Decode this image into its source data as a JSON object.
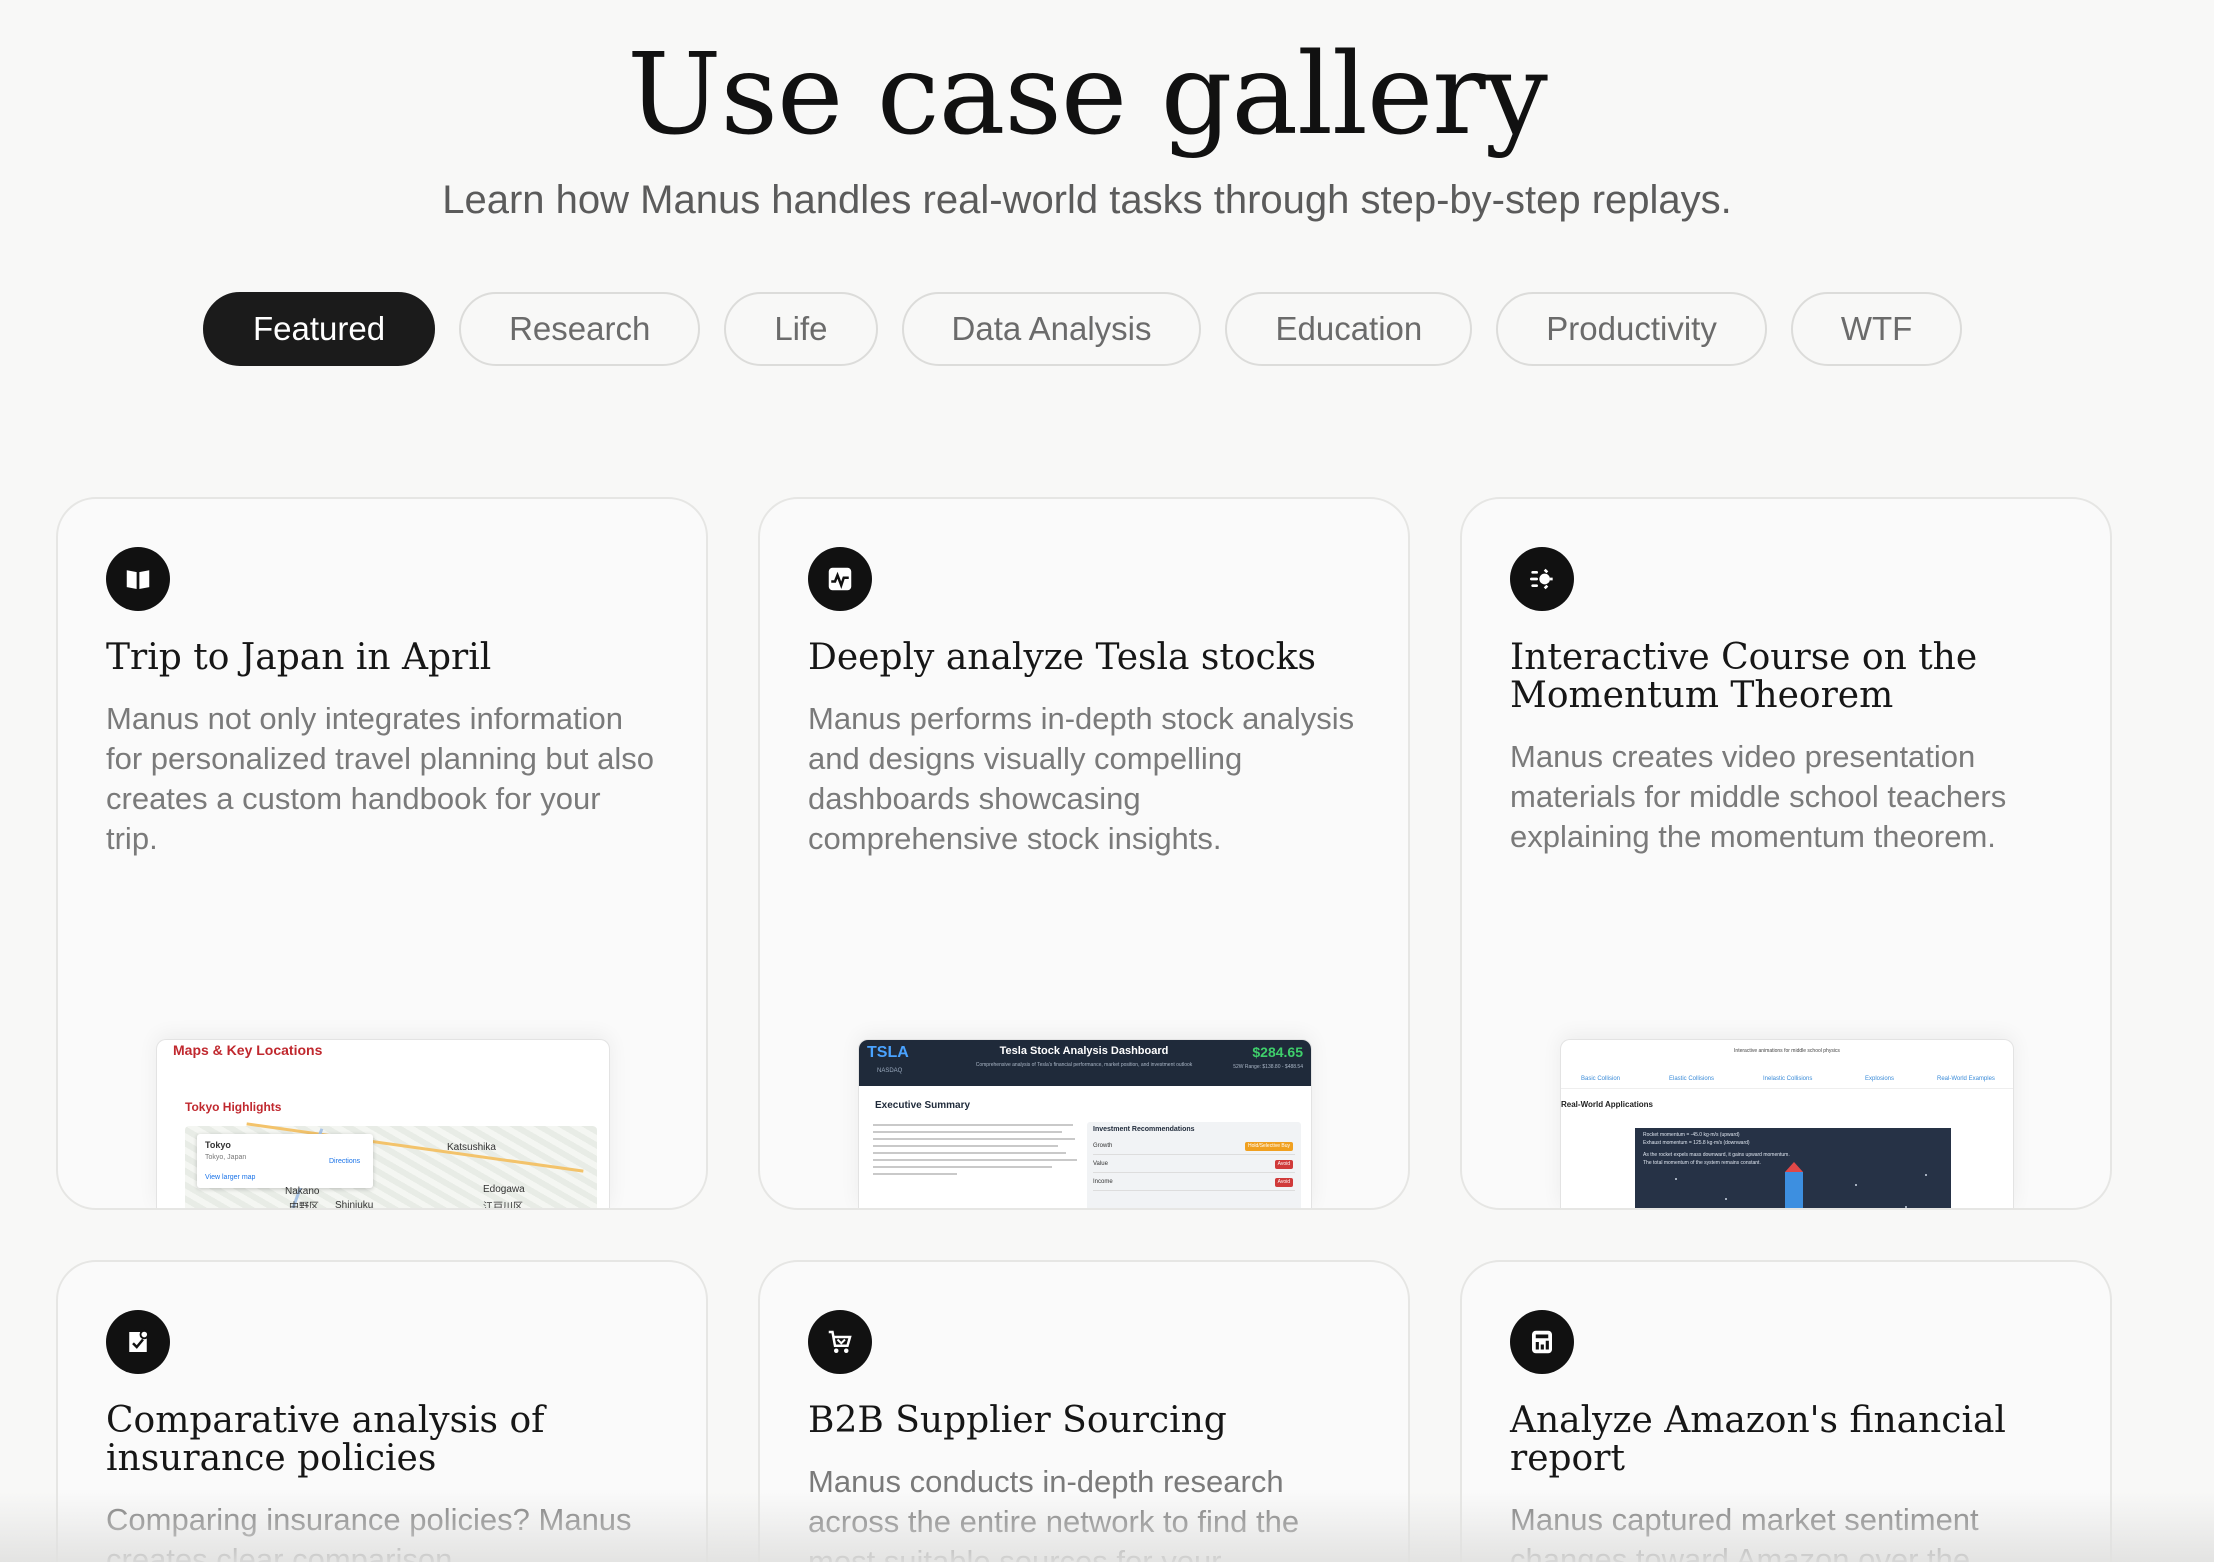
{
  "header": {
    "title": "Use case gallery",
    "subtitle": "Learn how Manus handles real-world tasks through step-by-step replays."
  },
  "tabs": [
    {
      "label": "Featured",
      "active": true
    },
    {
      "label": "Research",
      "active": false
    },
    {
      "label": "Life",
      "active": false
    },
    {
      "label": "Data Analysis",
      "active": false
    },
    {
      "label": "Education",
      "active": false
    },
    {
      "label": "Productivity",
      "active": false
    },
    {
      "label": "WTF",
      "active": false
    }
  ],
  "cards": [
    {
      "icon": "book-icon",
      "title": "Trip to Japan in April",
      "description": "Manus not only integrates information for personalized travel planning but also creates a custom handbook for your trip.",
      "preview": {
        "heading": "Maps & Key Locations",
        "subheading": "Tokyo Highlights",
        "place": "Tokyo",
        "place_sub": "Tokyo, Japan",
        "directions": "Directions",
        "view_map": "View larger map",
        "labels": [
          "Katsushika",
          "Edogawa",
          "Nakano",
          "Shinjuku",
          "江戸川区",
          "中野区"
        ]
      }
    },
    {
      "icon": "stock-chart-icon",
      "title": "Deeply analyze Tesla stocks",
      "description": "Manus performs in-depth stock analysis and designs visually compelling dashboards showcasing comprehensive stock insights.",
      "preview": {
        "symbol": "TSLA",
        "symbol_sub": "NASDAQ",
        "title": "Tesla Stock Analysis Dashboard",
        "subtitle": "Comprehensive analysis of Tesla's financial performance, market position, and investment outlook",
        "price": "$284.65",
        "range": "52W Range: $138.80 - $488.54",
        "section": "Executive Summary",
        "recs_heading": "Investment Recommendations",
        "recs": [
          {
            "label": "Growth",
            "badge": "Hold/Selective Buy",
            "color": "#f0a020"
          },
          {
            "label": "Value",
            "badge": "Avoid",
            "color": "#d03a3a"
          },
          {
            "label": "Income",
            "badge": "Avoid",
            "color": "#d03a3a"
          }
        ]
      }
    },
    {
      "icon": "momentum-icon",
      "title": "Interactive Course on the Momentum Theorem",
      "description": "Manus creates video presentation materials for middle school teachers explaining the momentum theorem.",
      "preview": {
        "top": "Interactive animations for middle school physics",
        "nav": [
          "Basic Collision",
          "Elastic Collisions",
          "Inelastic Collisions",
          "Explosions",
          "Real-World Examples"
        ],
        "section": "Real-World Applications",
        "scene_lines": [
          "Rocket momentum = -45.0 kg·m/s (upward)",
          "Exhaust momentum = 125.8 kg·m/s (downward)",
          "As the rocket expels mass downward, it gains upward momentum.",
          "The total momentum of the system remains constant."
        ]
      }
    },
    {
      "icon": "shield-check-icon",
      "title": "Comparative analysis of insurance policies",
      "description": "Comparing insurance policies? Manus creates clear comparison"
    },
    {
      "icon": "cart-icon",
      "title": "B2B Supplier Sourcing",
      "description": "Manus conducts in-depth research across the entire network to find the most suitable sources for your"
    },
    {
      "icon": "financial-report-icon",
      "title": "Analyze Amazon's financial report",
      "description": "Manus captured market sentiment changes toward Amazon over the"
    }
  ]
}
